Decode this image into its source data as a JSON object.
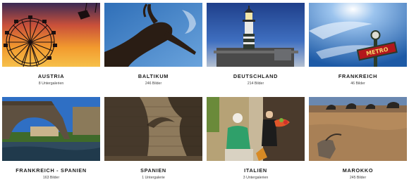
{
  "galleries": [
    {
      "title": "AUSTRIA",
      "count": "8 Untergalerien",
      "image": "ferris-wheel-sunset"
    },
    {
      "title": "BALTIKUM",
      "count": "246 Bilder",
      "image": "goat-silhouette"
    },
    {
      "title": "DEUTSCHLAND",
      "count": "214 Bilder",
      "image": "lighthouse"
    },
    {
      "title": "FRANKREICH",
      "count": "46 Bilder",
      "image": "metro-sign"
    },
    {
      "title": "FRANKREICH - SPANIEN",
      "count": "163 Bilder",
      "image": "stone-bridge"
    },
    {
      "title": "SPANIEN",
      "count": "1 Untergalerie",
      "image": "stone-wall-shadows"
    },
    {
      "title": "ITALIEN",
      "count": "3 Untergalerien",
      "image": "vegetable-vendor"
    },
    {
      "title": "MAROKKO",
      "count": "245 Bilder",
      "image": "desert-camels"
    }
  ]
}
